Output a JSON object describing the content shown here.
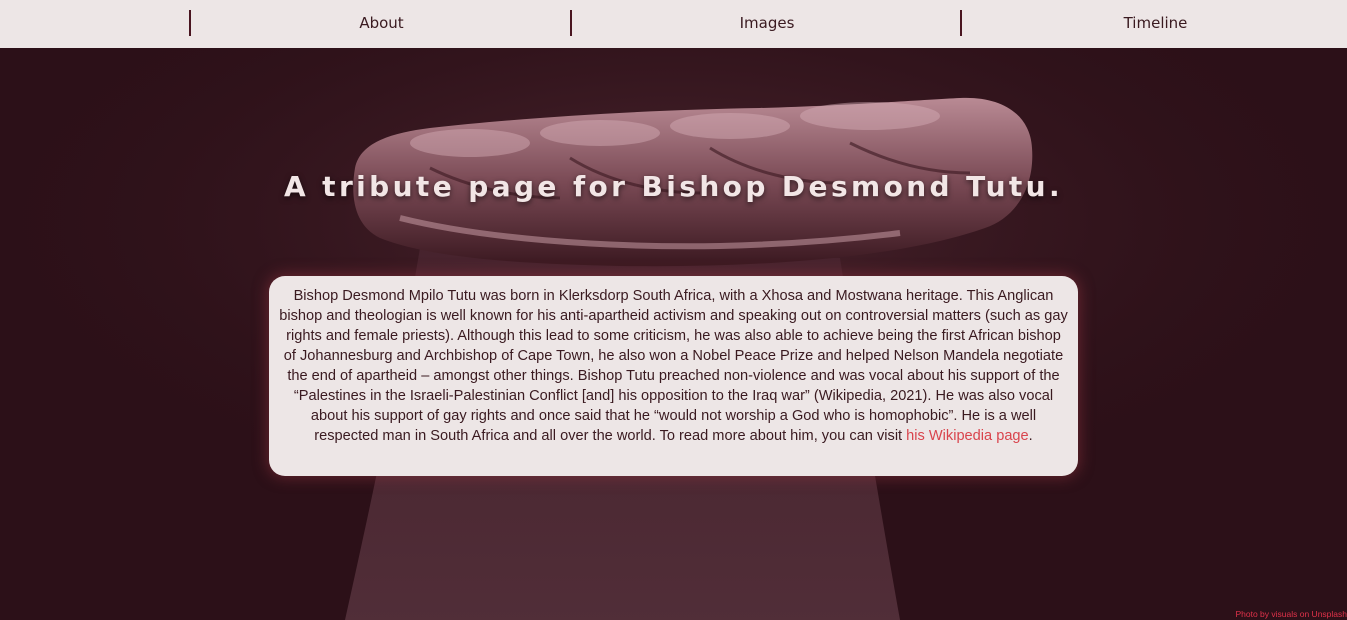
{
  "nav": {
    "items": [
      {
        "label": "About"
      },
      {
        "label": "Images"
      },
      {
        "label": "Timeline"
      }
    ]
  },
  "hero": {
    "title": "A tribute page for Bishop Desmond Tutu.",
    "bio_text": "Bishop Desmond Mpilo Tutu was born in Klerksdorp South Africa, with a Xhosa and Mostwana heritage. This Anglican bishop and theologian is well known for his anti-apartheid activism and speaking out on controversial matters (such as gay rights and female priests). Although this lead to some criticism, he was also able to achieve being the first African bishop of Johannesburg and Archbishop of Cape Town, he also won a Nobel Peace Prize and helped Nelson Mandela negotiate the end of apartheid – amongst other things. Bishop Tutu preached non-violence and was vocal about his support of the “Palestines in the Israeli-Palestinian Conflict [and] his opposition to the Iraq war” (Wikipedia, 2021). He was also vocal about his support of gay rights and once said that he “would not worship a God who is homophobic”. He is a well respected man in South Africa and all over the world. To read more about him, you can visit ",
    "link_text": "his Wikipedia page",
    "bio_end": "."
  },
  "credit": "Photo by visuals on Unsplash",
  "colors": {
    "nav_bg": "#ede6e6",
    "hero_bg": "#2c1018",
    "card_bg": "#ede6e6",
    "link": "#d9444d",
    "text": "#3a1a20",
    "title": "#f2e6e6"
  },
  "background_image": "raised-fist-photo"
}
